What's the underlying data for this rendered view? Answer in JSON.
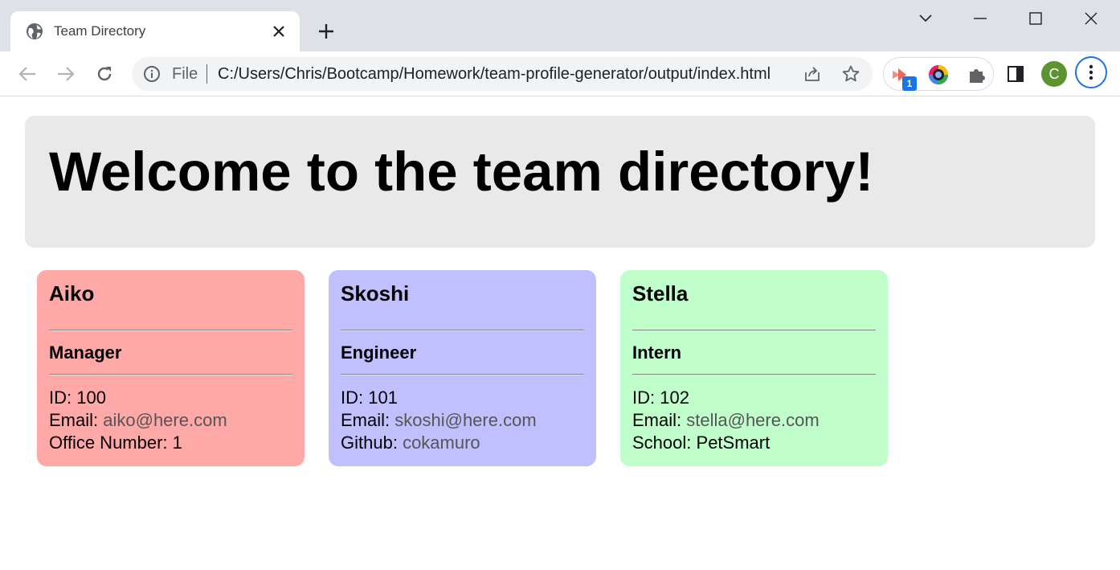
{
  "browser": {
    "tab_title": "Team Directory",
    "omnibox": {
      "scheme_label": "File",
      "url": "C:/Users/Chris/Bootcamp/Homework/team-profile-generator/output/index.html"
    },
    "extension_badge": "1",
    "profile_initial": "C"
  },
  "page": {
    "heading": "Welcome to the team directory!",
    "cards": [
      {
        "name": "Aiko",
        "role": "Manager",
        "color": "#ffa8a8",
        "id_label": "ID:",
        "id": "100",
        "email_label": "Email:",
        "email": "aiko@here.com",
        "extra_label": "Office Number:",
        "extra": "1"
      },
      {
        "name": "Skoshi",
        "role": "Engineer",
        "color": "#c0c0ff",
        "id_label": "ID:",
        "id": "101",
        "email_label": "Email:",
        "email": "skoshi@here.com",
        "extra_label": "Github:",
        "extra": "cokamuro"
      },
      {
        "name": "Stella",
        "role": "Intern",
        "color": "#c0ffcc",
        "id_label": "ID:",
        "id": "102",
        "email_label": "Email:",
        "email": "stella@here.com",
        "extra_label": "School:",
        "extra": "PetSmart"
      }
    ]
  }
}
